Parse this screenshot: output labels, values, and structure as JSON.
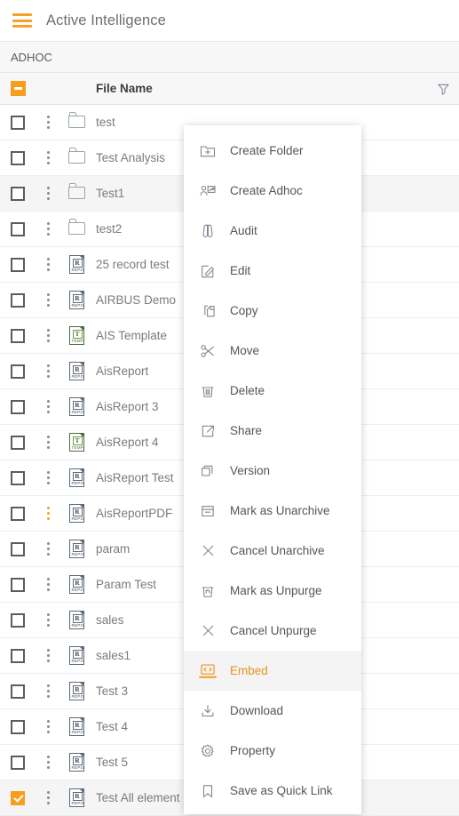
{
  "header": {
    "menu_icon": "hamburger-icon",
    "title": "Active Intelligence"
  },
  "breadcrumb": {
    "label": "ADHOC"
  },
  "table": {
    "select_all_state": "indeterminate",
    "columns": [
      "File Name"
    ],
    "filter_icon": "filter-icon",
    "rows": [
      {
        "name": "test",
        "type": "folder",
        "checked": false,
        "kebab_active": false,
        "highlight": false
      },
      {
        "name": "Test Analysis",
        "type": "folder",
        "checked": false,
        "kebab_active": false,
        "highlight": false
      },
      {
        "name": "Test1",
        "type": "folder",
        "checked": false,
        "kebab_active": false,
        "highlight": true
      },
      {
        "name": "test2",
        "type": "folder",
        "checked": false,
        "kebab_active": false,
        "highlight": false
      },
      {
        "name": "25 record test",
        "type": "report",
        "checked": false,
        "kebab_active": false,
        "highlight": false
      },
      {
        "name": "AIRBUS Demo",
        "type": "report",
        "checked": false,
        "kebab_active": false,
        "highlight": false
      },
      {
        "name": "AIS Template",
        "type": "template",
        "checked": false,
        "kebab_active": false,
        "highlight": false
      },
      {
        "name": "AisReport",
        "type": "report",
        "checked": false,
        "kebab_active": false,
        "highlight": false
      },
      {
        "name": "AisReport 3",
        "type": "report",
        "checked": false,
        "kebab_active": false,
        "highlight": false
      },
      {
        "name": "AisReport 4",
        "type": "template",
        "checked": false,
        "kebab_active": false,
        "highlight": false
      },
      {
        "name": "AisReport Test",
        "type": "report",
        "checked": false,
        "kebab_active": false,
        "highlight": false
      },
      {
        "name": "AisReportPDF",
        "type": "report",
        "checked": false,
        "kebab_active": true,
        "highlight": false
      },
      {
        "name": "param",
        "type": "report",
        "checked": false,
        "kebab_active": false,
        "highlight": false
      },
      {
        "name": "Param Test",
        "type": "report",
        "checked": false,
        "kebab_active": false,
        "highlight": false
      },
      {
        "name": "sales",
        "type": "report",
        "checked": false,
        "kebab_active": false,
        "highlight": false
      },
      {
        "name": "sales1",
        "type": "report",
        "checked": false,
        "kebab_active": false,
        "highlight": false
      },
      {
        "name": "Test 3",
        "type": "report",
        "checked": false,
        "kebab_active": false,
        "highlight": false
      },
      {
        "name": "Test 4",
        "type": "report",
        "checked": false,
        "kebab_active": false,
        "highlight": false
      },
      {
        "name": "Test 5",
        "type": "report",
        "checked": false,
        "kebab_active": false,
        "highlight": false
      },
      {
        "name": "Test All element",
        "type": "report",
        "checked": true,
        "kebab_active": false,
        "highlight": true
      }
    ],
    "file_badges": {
      "report": "R",
      "template": "T"
    },
    "file_tags": {
      "report": "REPO",
      "template": "TEMP"
    }
  },
  "context_menu": {
    "items": [
      {
        "label": "Create Folder",
        "icon": "folder-plus-icon",
        "highlight": false
      },
      {
        "label": "Create Adhoc",
        "icon": "user-chart-icon",
        "highlight": false
      },
      {
        "label": "Audit",
        "icon": "binoculars-icon",
        "highlight": false
      },
      {
        "label": "Edit",
        "icon": "pencil-square-icon",
        "highlight": false
      },
      {
        "label": "Copy",
        "icon": "copy-icon",
        "highlight": false
      },
      {
        "label": "Move",
        "icon": "scissors-icon",
        "highlight": false
      },
      {
        "label": "Delete",
        "icon": "trash-icon",
        "highlight": false
      },
      {
        "label": "Share",
        "icon": "share-icon",
        "highlight": false
      },
      {
        "label": "Version",
        "icon": "layers-icon",
        "highlight": false
      },
      {
        "label": "Mark as Unarchive",
        "icon": "archive-box-icon",
        "highlight": false
      },
      {
        "label": "Cancel Unarchive",
        "icon": "close-x-icon",
        "highlight": false
      },
      {
        "label": "Mark as Unpurge",
        "icon": "trash-undo-icon",
        "highlight": false
      },
      {
        "label": "Cancel Unpurge",
        "icon": "close-x-icon",
        "highlight": false
      },
      {
        "label": "Embed",
        "icon": "embed-code-icon",
        "highlight": true
      },
      {
        "label": "Download",
        "icon": "download-icon",
        "highlight": false
      },
      {
        "label": "Property",
        "icon": "gear-icon",
        "highlight": false
      },
      {
        "label": "Save as Quick Link",
        "icon": "bookmark-icon",
        "highlight": false
      }
    ]
  },
  "colors": {
    "accent": "#f5a01d",
    "header_bg": "#f7f7f7",
    "row_alt": "#f5f5f5",
    "text": "#7b7b7b"
  }
}
